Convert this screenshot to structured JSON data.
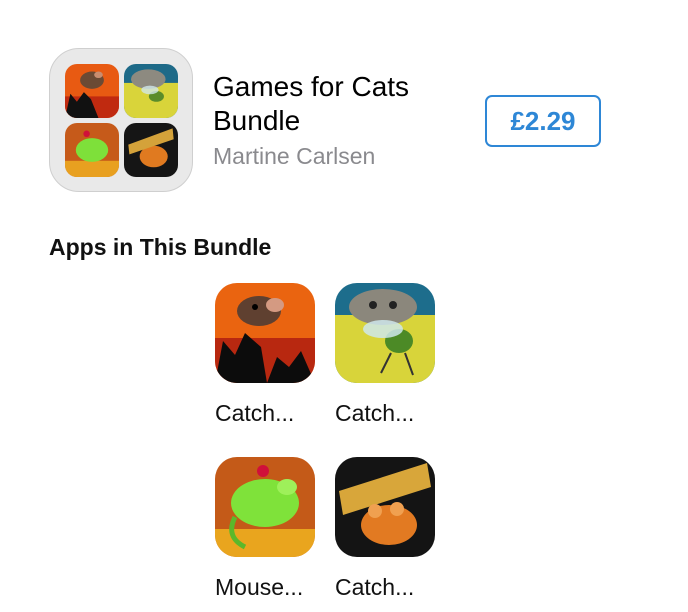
{
  "bundle": {
    "title": "Games for Cats Bundle",
    "developer": "Martine Carlsen",
    "price": "£2.29",
    "icon": "bundle-collage-icon"
  },
  "section": {
    "heading": "Apps in This Bundle"
  },
  "apps": [
    {
      "name": "Catch...",
      "icon": "catch-mole-icon"
    },
    {
      "name": "Catch...",
      "icon": "catch-bug-icon"
    },
    {
      "name": "Mouse...",
      "icon": "mouse-icon"
    },
    {
      "name": "Catch...",
      "icon": "catch-the-mouse-icon"
    }
  ],
  "colors": {
    "accent": "#2e87d6",
    "secondary_text": "#8a8a8e",
    "icon_bg": "#e9e9e9"
  }
}
